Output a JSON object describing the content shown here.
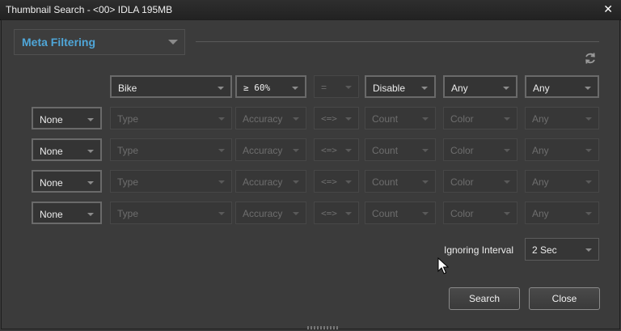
{
  "window": {
    "title": "Thumbnail Search - <00> IDLA 195MB"
  },
  "meta_filter": {
    "label": "Meta Filtering"
  },
  "header_row": {
    "object": "Bike",
    "accuracy": "≥ 60%",
    "operator": "=",
    "count": "Disable",
    "color": "Any",
    "extra": "Any"
  },
  "rows": [
    {
      "logic": "None",
      "type": "Type",
      "accuracy": "Accuracy",
      "operator": "<=>",
      "count": "Count",
      "color": "Color",
      "extra": "Any"
    },
    {
      "logic": "None",
      "type": "Type",
      "accuracy": "Accuracy",
      "operator": "<=>",
      "count": "Count",
      "color": "Color",
      "extra": "Any"
    },
    {
      "logic": "None",
      "type": "Type",
      "accuracy": "Accuracy",
      "operator": "<=>",
      "count": "Count",
      "color": "Color",
      "extra": "Any"
    },
    {
      "logic": "None",
      "type": "Type",
      "accuracy": "Accuracy",
      "operator": "<=>",
      "count": "Count",
      "color": "Color",
      "extra": "Any"
    }
  ],
  "interval": {
    "label": "Ignoring Interval",
    "value": "2 Sec"
  },
  "buttons": {
    "search": "Search",
    "close": "Close"
  },
  "icons": {
    "close": "close-icon",
    "refresh": "refresh-icon",
    "cursor": "mouse-cursor-icon"
  },
  "colors": {
    "accent": "#4fa6d8",
    "background": "#3b3b3b"
  }
}
